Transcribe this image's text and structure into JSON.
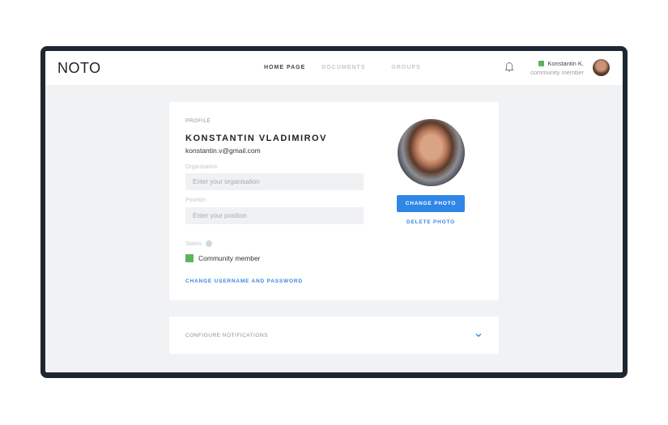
{
  "header": {
    "logo": "NOTO",
    "nav": [
      "HOME PAGE",
      "DOCUMENTS",
      "GROUPS"
    ],
    "user_name": "Konstantin K.",
    "user_role": "community member"
  },
  "profile": {
    "section_label": "PROFILE",
    "full_name": "KONSTANTIN VLADIMIROV",
    "email": "konstantin.v@gmail.com",
    "organisation_label": "Organisation",
    "organisation_placeholder": "Enter your organisation",
    "organisation_value": "",
    "position_label": "Position",
    "position_placeholder": "Enter your position",
    "position_value": "",
    "status_label": "Status",
    "status_value": "Community member",
    "change_credentials": "CHANGE USERNAME AND PASSWORD",
    "change_photo": "CHANGE PHOTO",
    "delete_photo": "DELETE PHOTO"
  },
  "notifications": {
    "label": "CONFIGURE NOTIFICATIONS"
  },
  "colors": {
    "accent": "#2e86e6",
    "status_green": "#5bb45e",
    "frame": "#1e2731"
  }
}
